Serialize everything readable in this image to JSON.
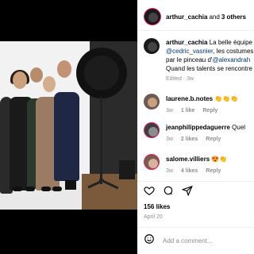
{
  "post": {
    "header": {
      "username": "arthur_cachia",
      "with_text": "and",
      "others": "3 others"
    },
    "caption": {
      "username": "arthur_cachia",
      "line1": "La belle équipe",
      "line2_mention": "@cedric_vasnier",
      "line2_text": ", les costumes",
      "line3_text": "par le pinceau d'",
      "line3_mention": "@alexandrah",
      "line4_text": "Quand les talents se rencontre",
      "meta": "Edited · 3w"
    },
    "comments": [
      {
        "username": "laurene.b.notes",
        "text": "👏👏👏",
        "age": "3w",
        "likes": "1 like",
        "reply": "Reply"
      },
      {
        "username": "jeanphilippedaguerre",
        "text": "Quel",
        "age": "3w",
        "likes": "2 likes",
        "reply": "Reply"
      },
      {
        "username": "salome.villiers",
        "text": "😍👏",
        "age": "3w",
        "likes": "4 likes",
        "reply": "Reply"
      }
    ],
    "likes": "156 likes",
    "date": "April 20",
    "add_comment_placeholder": "Add a comment..."
  },
  "icons": {
    "like": "heart-icon",
    "comment": "comment-bubble-icon",
    "share": "paper-plane-icon",
    "emoji": "smiley-face-icon"
  }
}
